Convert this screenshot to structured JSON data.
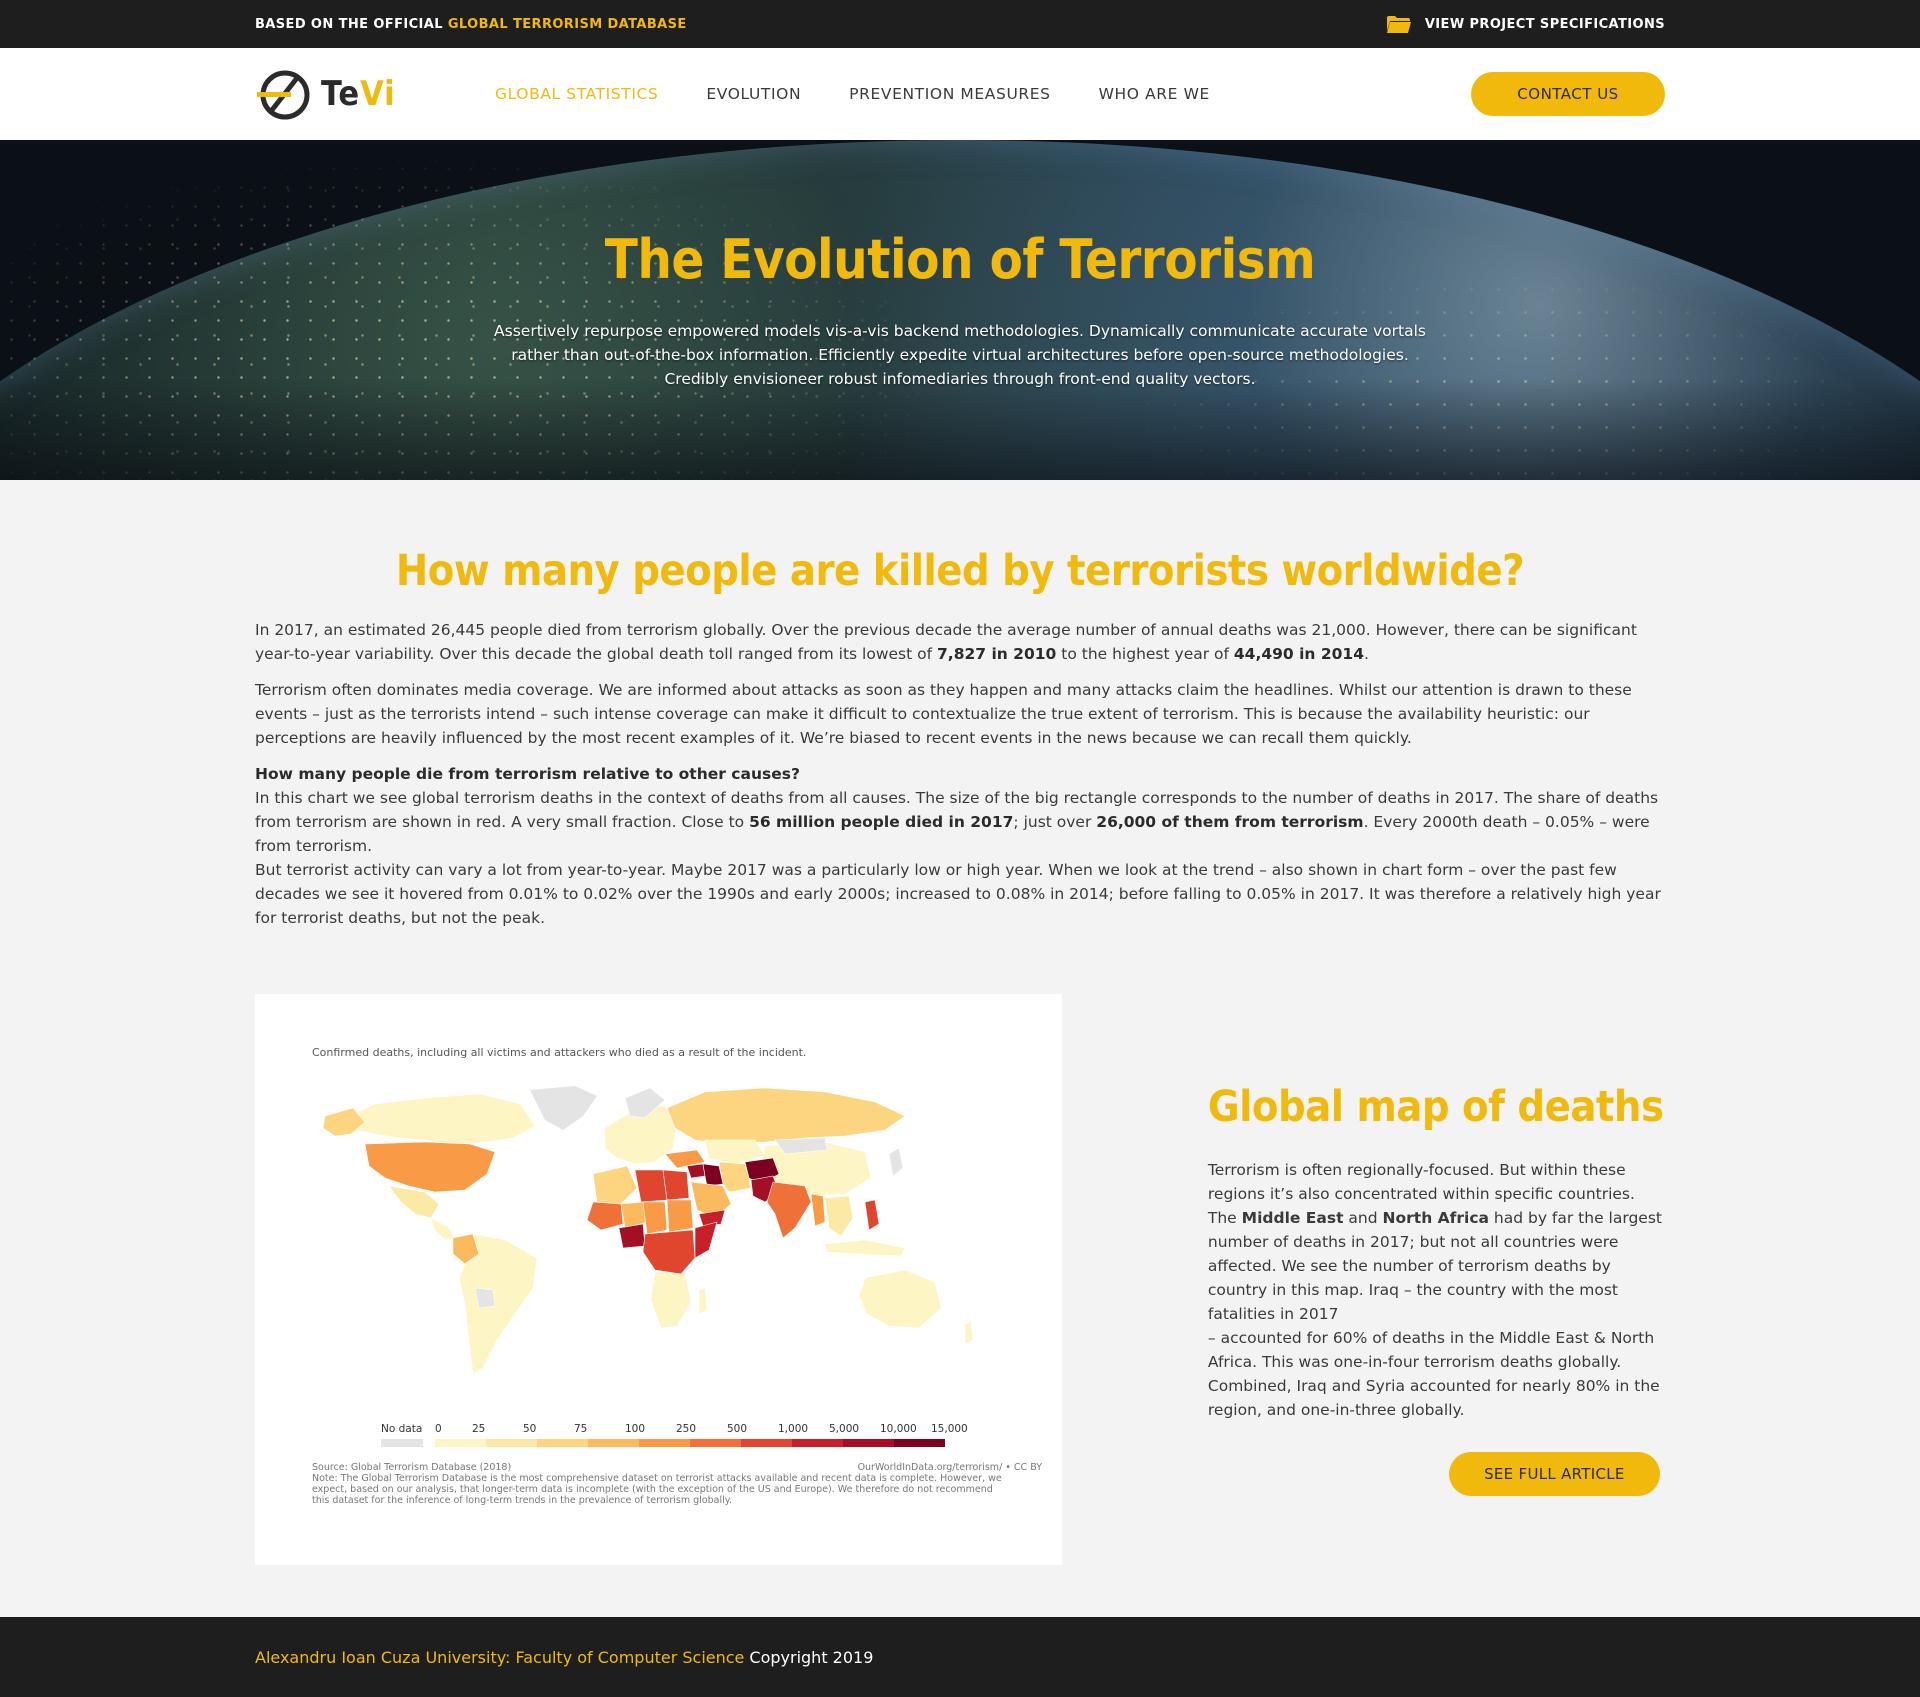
{
  "topbar": {
    "prefix": "BASED ON THE OFFICIAL",
    "highlight": "GLOBAL TERRORISM DATABASE",
    "specs_label": "VIEW PROJECT SPECIFICATIONS",
    "specs_icon": "folder-icon"
  },
  "brand": {
    "name_part1": "Te",
    "name_part2": "Vi",
    "accent_color": "#f2b90d"
  },
  "nav": {
    "items": [
      {
        "label": "GLOBAL STATISTICS",
        "active": true
      },
      {
        "label": "EVOLUTION",
        "active": false
      },
      {
        "label": "PREVENTION MEASURES",
        "active": false
      },
      {
        "label": "WHO ARE WE",
        "active": false
      }
    ],
    "contact_label": "CONTACT US"
  },
  "hero": {
    "title": "The Evolution of Terrorism",
    "text": "Assertively repurpose empowered models vis-a-vis backend methodologies. Dynamically communicate accurate vortals rather than out-of-the-box information. Efficiently expedite virtual architectures before open-source methodologies. Credibly envisioneer robust infomediaries through front-end quality vectors."
  },
  "main": {
    "title": "How many people are killed by terrorists worldwide?",
    "p1_a": "In 2017, an estimated 26,445 people died from terrorism globally. Over the previous decade the average number of annual deaths was 21,000. However, there can be significant year-to-year variability. Over this decade the global death toll ranged from its lowest of ",
    "p1_b": "7,827 in 2010",
    "p1_c": " to the highest year of ",
    "p1_d": "44,490 in 2014",
    "p1_e": ".",
    "p2": "Terrorism often dominates media coverage. We are informed about attacks as soon as they happen and many attacks claim the headlines. Whilst our attention is drawn to these events – just as the terrorists intend – such intense coverage can make it difficult to contextualize the true extent of terrorism. This is because the availability heuristic: our perceptions are heavily influenced by the most recent examples of it. We’re biased to recent events in the news because we can recall them quickly.",
    "p3_heading": "How many people die from terrorism relative to other causes?",
    "p3_a": "In this chart we see global terrorism deaths in the context of deaths from all causes. The size of the big rectangle corresponds to the number of deaths in 2017. The share of deaths from terrorism are shown in red. A very small fraction.  Close to ",
    "p3_b": "56 million people died in 2017",
    "p3_c": "; just over ",
    "p3_d": "26,000 of them from terrorism",
    "p3_e": ". Every 2000th death – 0.05% – were from terrorism.",
    "p3_f": "But terrorist activity can vary a lot from year-to-year. Maybe 2017 was a particularly low or high year. When we look at the trend – also shown in chart form – over the past few decades we see it hovered from 0.01% to 0.02% over the 1990s and early 2000s; increased to 0.08% in 2014; before falling to 0.05% in 2017. It was therefore a relatively high year for terrorist deaths, but not the peak."
  },
  "map": {
    "caption": "Confirmed deaths, including all victims and attackers who died as a result of the incident.",
    "legend_nodata": "No data",
    "legend_ticks": [
      "0",
      "25",
      "50",
      "75",
      "100",
      "250",
      "500",
      "1,000",
      "5,000",
      "10,000",
      "15,000"
    ],
    "legend_colors": [
      "#fdf5c4",
      "#fde9a6",
      "#fdd580",
      "#fcba5e",
      "#f99a47",
      "#f0703a",
      "#e0452e",
      "#c8202a",
      "#a50f26",
      "#7d0020"
    ],
    "nodata_color": "#e4e4e4",
    "source_left": "Source: Global Terrorism Database (2018)",
    "source_right": "OurWorldInData.org/terrorism/ • CC BY",
    "note": "Note: The Global Terrorism Database is the most comprehensive dataset on terrorist attacks available and recent data is complete. However, we expect, based on our analysis, that longer-term data is incomplete (with the exception of the US and Europe). We therefore do not recommend this dataset for the inference of long-term trends in the prevalence of terrorism globally."
  },
  "side": {
    "title": "Global map of deaths",
    "t1": "Terrorism is often regionally-focused. But within these regions it’s also concentrated within specific countries. The ",
    "t2": "Middle East",
    "t3": " and ",
    "t4": "North Africa",
    "t5": " had by far the largest number of deaths in 2017; but not all countries were affected. We see the number of terrorism deaths by country in this map. Iraq – the country with the most fatalities in 2017",
    "t6": "– accounted for 60% of deaths in the Middle East & North Africa. This was one-in-four terrorism deaths globally. Combined, Iraq and Syria accounted for nearly 80% in the region, and one-in-three globally.",
    "button": "SEE FULL ARTICLE"
  },
  "footer": {
    "university": "Alexandru Ioan Cuza University: Faculty of Computer Science",
    "copyright": "Copyright  2019"
  }
}
